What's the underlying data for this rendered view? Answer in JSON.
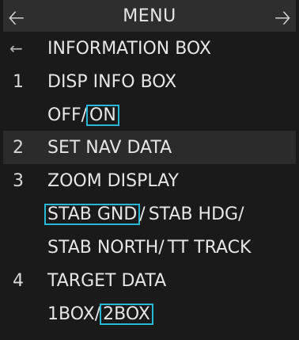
{
  "header": {
    "title": "MENU",
    "left_icon": "arrow-left-icon",
    "right_icon": "arrow-right-icon"
  },
  "back_row": {
    "glyph": "←",
    "label": "INFORMATION BOX"
  },
  "items": [
    {
      "number": "1",
      "label": "DISP INFO BOX",
      "options": [
        "OFF",
        "ON"
      ],
      "selected": "ON"
    },
    {
      "number": "2",
      "label": "SET NAV DATA"
    },
    {
      "number": "3",
      "label": "ZOOM DISPLAY",
      "options": [
        "STAB GND",
        "STAB HDG",
        "STAB NORTH",
        "TT TRACK"
      ],
      "selected": "STAB GND"
    },
    {
      "number": "4",
      "label": "TARGET DATA",
      "options": [
        "1BOX",
        "2BOX"
      ],
      "selected": "2BOX"
    }
  ],
  "separator": "/",
  "colors": {
    "background": "#1a1a1a",
    "header_bg": "#2e2e2e",
    "row_alt_bg": "#2b2b2b",
    "text": "#e6e6e6",
    "selection_outline": "#27b6d6"
  }
}
